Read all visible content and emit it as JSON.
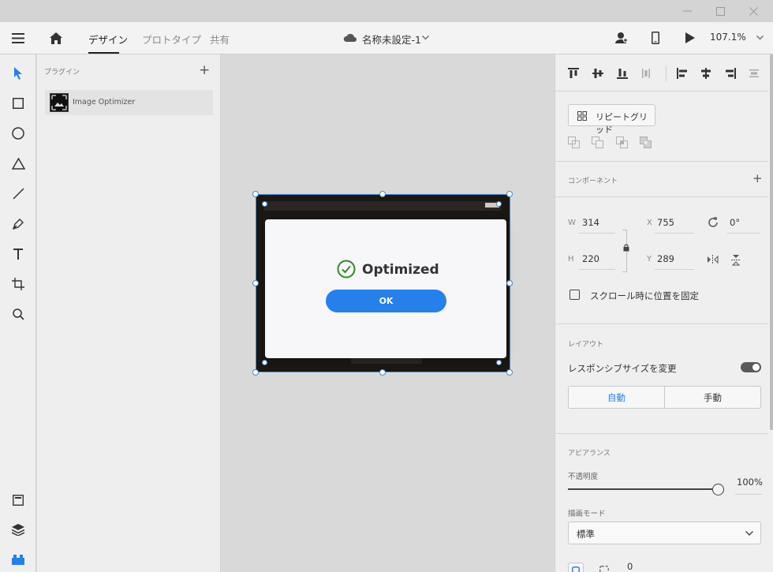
{
  "window": {
    "minimize": "—",
    "maximize": "☐",
    "close": "✕"
  },
  "header": {
    "tabs": [
      "デザイン",
      "プロトタイプ",
      "共有"
    ],
    "active_tab": "デザイン",
    "document_title": "名称未設定-1",
    "zoom": "107.1%"
  },
  "toolbar": {
    "tools": [
      "select-tool",
      "rectangle-tool",
      "ellipse-tool",
      "polygon-tool",
      "line-tool",
      "pen-tool",
      "text-tool",
      "artboard-tool",
      "zoom-tool"
    ],
    "bottom": [
      "assets-panel",
      "layers-panel",
      "plugins-panel"
    ]
  },
  "plugins_panel": {
    "title": "プラグイン",
    "add": "+",
    "items": [
      {
        "name": "Image Optimizer"
      }
    ]
  },
  "canvas": {
    "dialog_title": "Optimized",
    "dialog_button": "OK"
  },
  "properties": {
    "repeat_grid": "リピートグリッド",
    "component_title": "コンポーネント",
    "add": "+",
    "width_label": "W",
    "width": "314",
    "height_label": "H",
    "height": "220",
    "x_label": "X",
    "x": "755",
    "y_label": "Y",
    "y": "289",
    "rotation": "0°",
    "fix_position_label": "スクロール時に位置を固定",
    "fix_position_checked": false,
    "layout_title": "レイアウト",
    "responsive_resize_label": "レスポンシブサイズを変更",
    "responsive_resize_on": true,
    "layout_modes": [
      "自動",
      "手動"
    ],
    "layout_mode_selected": "自動",
    "appearance_title": "アピアランス",
    "opacity_label": "不透明度",
    "opacity": "100%",
    "opacity_value": 1.0,
    "blend_mode_label": "描画モード",
    "blend_mode": "標準",
    "corner_radius": "0"
  },
  "colors": {
    "accent": "#2680eb",
    "selection": "#4a89c6",
    "success": "#2d8c22"
  }
}
